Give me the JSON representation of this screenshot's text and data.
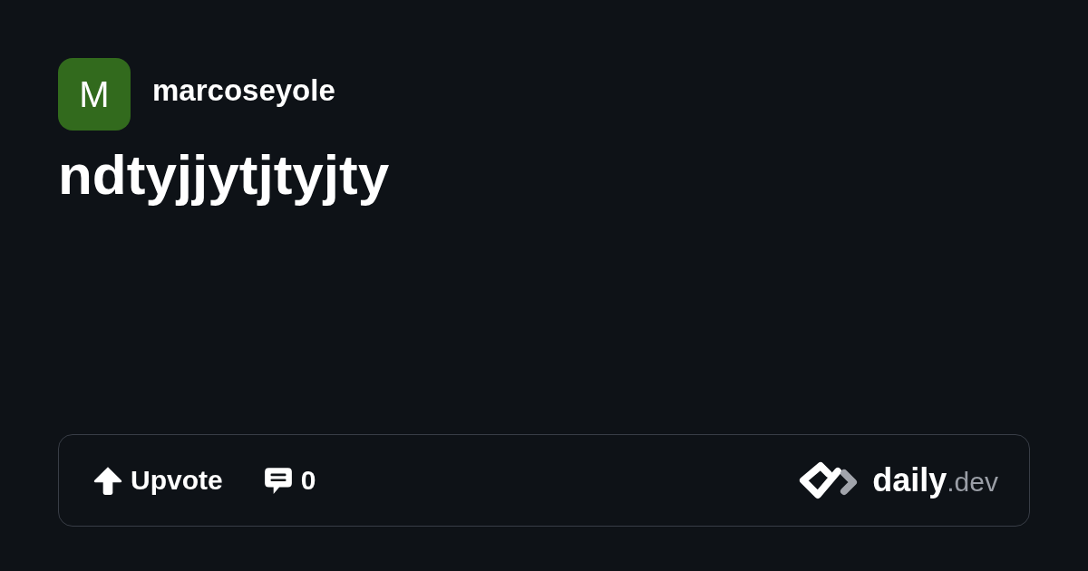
{
  "author": {
    "avatar_letter": "M",
    "name": "marcoseyole"
  },
  "post": {
    "title": "ndtyjjytjtyjty"
  },
  "footer": {
    "upvote_label": "Upvote",
    "comment_count": "0",
    "logo": {
      "name": "daily",
      "suffix": ".dev"
    }
  }
}
